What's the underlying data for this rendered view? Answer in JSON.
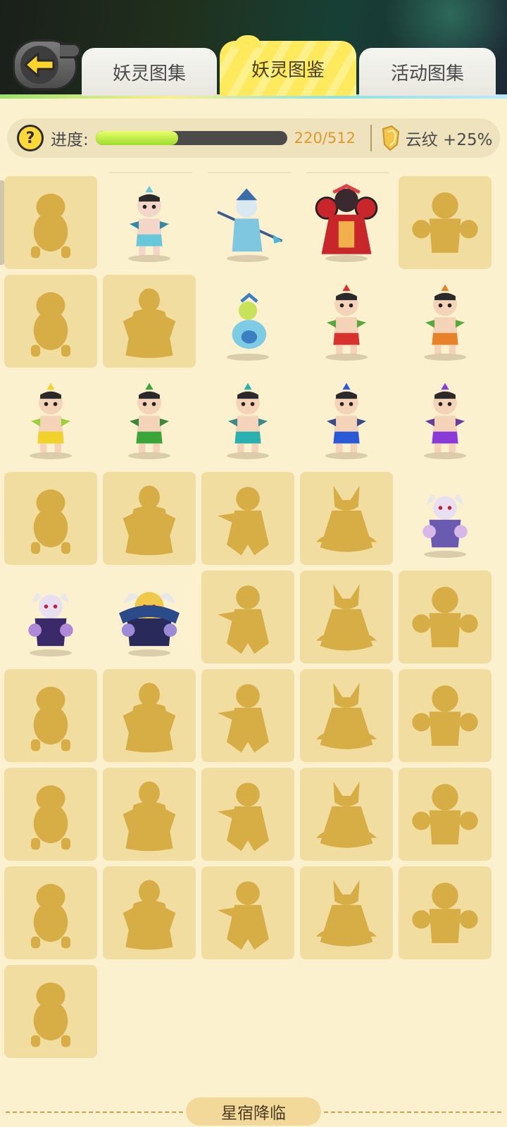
{
  "colors": {
    "accent_tab": "#ffe95c",
    "silhouette": "#d7ad45",
    "locked_bg": "#f2dda0",
    "page_bg": "#fcf1cf",
    "progress_fill": "#9fdc2b",
    "progress_count": "#e09a2a"
  },
  "nav": {
    "back_icon": "arrow-left-icon",
    "tabs": [
      {
        "label": "妖灵图集",
        "active": false
      },
      {
        "label": "妖灵图鉴",
        "active": true
      },
      {
        "label": "活动图集",
        "active": false
      }
    ]
  },
  "progress": {
    "help_icon": "question-icon",
    "help_glyph": "?",
    "label": "进度:",
    "current": 220,
    "total": 512,
    "text": "220/512",
    "bonus_icon": "cloud-pattern-icon",
    "bonus_text": "云纹 +25%"
  },
  "collection": {
    "rows": [
      [
        "locked",
        "blue-imp",
        "spear-warrior",
        "red-armored-boss",
        "locked"
      ],
      [
        "locked",
        "locked",
        "gourd-sprite",
        "calabash-red",
        "calabash-orange"
      ],
      [
        "calabash-yellow",
        "calabash-green",
        "calabash-cyan",
        "calabash-blue",
        "calabash-purple"
      ],
      [
        "locked",
        "locked",
        "locked",
        "locked",
        "horned-imp-small"
      ],
      [
        "horned-imp-brawler",
        "horned-demon-lord",
        "locked",
        "locked",
        "locked"
      ],
      [
        "locked",
        "locked",
        "locked",
        "locked",
        "locked"
      ],
      [
        "locked",
        "locked",
        "locked",
        "locked",
        "locked"
      ],
      [
        "locked",
        "locked",
        "locked",
        "locked",
        "locked"
      ],
      [
        "locked"
      ]
    ]
  },
  "footer": {
    "label": "星宿降临"
  }
}
